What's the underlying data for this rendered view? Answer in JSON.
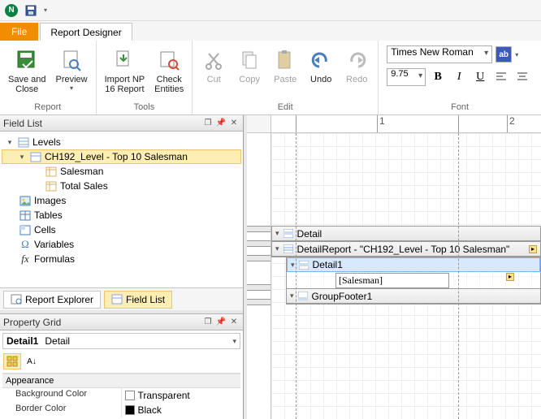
{
  "tabs": {
    "file": "File",
    "designer": "Report Designer"
  },
  "ribbon": {
    "report": {
      "label": "Report",
      "save_close": "Save and\nClose",
      "preview": "Preview"
    },
    "tools": {
      "label": "Tools",
      "import": "Import NP\n16 Report",
      "check": "Check\nEntities"
    },
    "edit": {
      "label": "Edit",
      "cut": "Cut",
      "copy": "Copy",
      "paste": "Paste",
      "undo": "Undo",
      "redo": "Redo"
    },
    "font": {
      "label": "Font",
      "family": "Times New Roman",
      "size": "9.75",
      "bold": "B",
      "italic": "I",
      "underline": "U"
    }
  },
  "panels": {
    "field_list_title": "Field List",
    "prop_grid_title": "Property Grid"
  },
  "tree": {
    "root": "Levels",
    "level": "CH192_Level - Top 10 Salesman",
    "fields": [
      "Salesman",
      "Total Sales"
    ],
    "others": [
      "Images",
      "Tables",
      "Cells",
      "Variables",
      "Formulas"
    ]
  },
  "bottom_tabs": {
    "explorer": "Report Explorer",
    "field_list": "Field List"
  },
  "prop": {
    "object_name": "Detail1",
    "object_type": "Detail",
    "cat_appearance": "Appearance",
    "rows": [
      {
        "key": "Background Color",
        "val": "Transparent",
        "swatch": "#ffffff"
      },
      {
        "key": "Border Color",
        "val": "Black",
        "swatch": "#000000"
      }
    ]
  },
  "ruler": {
    "ticks": [
      "1",
      "2"
    ]
  },
  "bands": {
    "detail": "Detail",
    "report": "DetailReport - \"CH192_Level - Top 10 Salesman\"",
    "detail1": "Detail1",
    "groupfooter": "GroupFooter1",
    "cell": "[Salesman]"
  }
}
